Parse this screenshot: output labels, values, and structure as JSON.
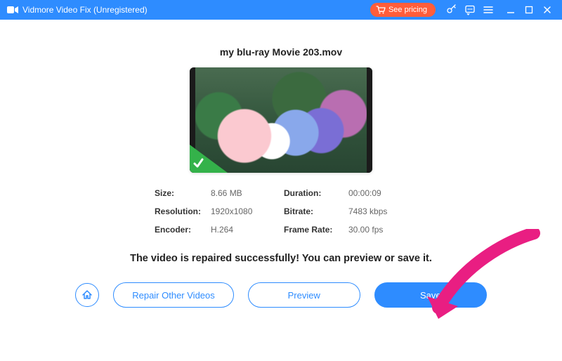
{
  "titlebar": {
    "app_title": "Vidmore Video Fix (Unregistered)",
    "see_pricing": "See pricing"
  },
  "file": {
    "name": "my blu-ray Movie 203.mov"
  },
  "info": {
    "size_label": "Size:",
    "size_value": "8.66 MB",
    "duration_label": "Duration:",
    "duration_value": "00:00:09",
    "resolution_label": "Resolution:",
    "resolution_value": "1920x1080",
    "bitrate_label": "Bitrate:",
    "bitrate_value": "7483 kbps",
    "encoder_label": "Encoder:",
    "encoder_value": "H.264",
    "framerate_label": "Frame Rate:",
    "framerate_value": "30.00 fps"
  },
  "status_message": "The video is repaired successfully! You can preview or save it.",
  "buttons": {
    "repair_other": "Repair Other Videos",
    "preview": "Preview",
    "save": "Save"
  },
  "colors": {
    "accent": "#2e8cff",
    "pricing_bg": "#ff5d3a",
    "success": "#34b24a",
    "annotation": "#e91e82"
  }
}
